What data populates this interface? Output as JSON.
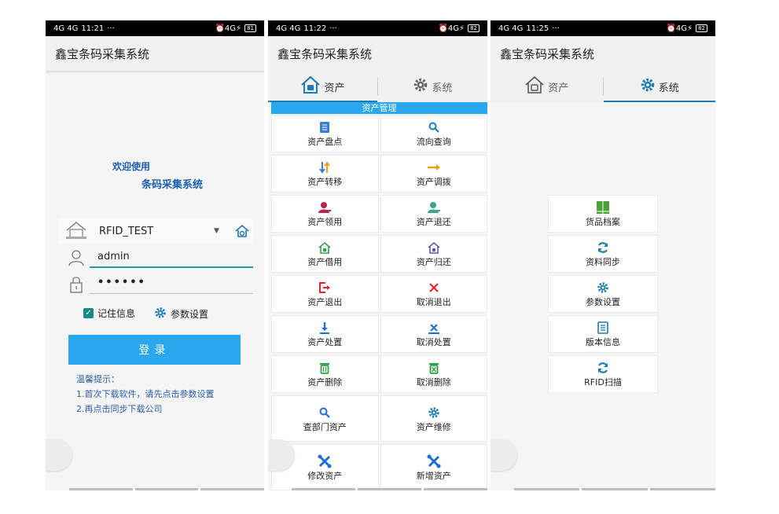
{
  "colors": {
    "accent": "#29a8f0",
    "title_blue": "#1d5fb0",
    "teal": "#1a8a7d",
    "tab_underline": "#1f7bb0"
  },
  "screen1": {
    "status": {
      "signal": "4G 4G",
      "time": "11:21",
      "dots": "···",
      "right": "⏰4G⚡",
      "battery": "81"
    },
    "app_title": "鑫宝条码采集系统",
    "welcome_line1": "欢迎使用",
    "welcome_line2": "条码采集系统",
    "database": {
      "value": "RFID_TEST",
      "icon": "company-house-icon"
    },
    "username": {
      "value": "admin"
    },
    "password": {
      "value": "••••••"
    },
    "remember_label": "记住信息",
    "params_label": "参数设置",
    "login_label": "登录",
    "tips": {
      "title": "温馨提示：",
      "line1": "1.首次下载软件，请先点击参数设置",
      "line2": "2.再点击同步下载公司"
    }
  },
  "screen2": {
    "status": {
      "signal": "4G 4G",
      "time": "11:22",
      "dots": "···",
      "right": "⏰4G⚡",
      "battery": "82"
    },
    "app_title": "鑫宝条码采集系统",
    "tabs": [
      {
        "label": "资产",
        "active": true
      },
      {
        "label": "系统",
        "active": false
      }
    ],
    "section_title": "资产管理",
    "items": [
      {
        "label": "资产盘点",
        "icon": "clipboard-icon",
        "color": "#3b7fd4"
      },
      {
        "label": "流向查询",
        "icon": "search-icon",
        "color": "#1f7bb0"
      },
      {
        "label": "资产转移",
        "icon": "transfer-arrows-icon",
        "color": "#3b7fd4"
      },
      {
        "label": "资产调拨",
        "icon": "arrow-right-icon",
        "color": "#f29b18"
      },
      {
        "label": "资产领用",
        "icon": "person-red-icon",
        "color": "#b5264a"
      },
      {
        "label": "资产退还",
        "icon": "person-teal-icon",
        "color": "#3aa58d"
      },
      {
        "label": "资产借用",
        "icon": "home-green-icon",
        "color": "#2fa144"
      },
      {
        "label": "资产归还",
        "icon": "home-purple-icon",
        "color": "#6a4fb0"
      },
      {
        "label": "资产退出",
        "icon": "exit-icon",
        "color": "#e2262c"
      },
      {
        "label": "取消退出",
        "icon": "close-icon",
        "color": "#e2262c"
      },
      {
        "label": "资产处置",
        "icon": "download-icon",
        "color": "#1f6fd1"
      },
      {
        "label": "取消处置",
        "icon": "cancel-download-icon",
        "color": "#1f6fd1"
      },
      {
        "label": "资产删除",
        "icon": "trash-icon",
        "color": "#2fa144"
      },
      {
        "label": "取消删除",
        "icon": "trash-cancel-icon",
        "color": "#2fa144"
      },
      {
        "label": "查部门资产",
        "icon": "search-icon",
        "color": "#1f6fd1"
      },
      {
        "label": "资产维修",
        "icon": "gear-icon",
        "color": "#1f7bb0"
      },
      {
        "label": "修改资产",
        "icon": "tools-icon",
        "color": "#1f6fd1"
      },
      {
        "label": "新增资产",
        "icon": "tools-icon",
        "color": "#1f6fd1"
      }
    ]
  },
  "screen3": {
    "status": {
      "signal": "4G 4G",
      "time": "11:25",
      "dots": "···",
      "right": "⏰4G⚡",
      "battery": "82"
    },
    "app_title": "鑫宝条码采集系统",
    "tabs": [
      {
        "label": "资产",
        "active": false
      },
      {
        "label": "系统",
        "active": true
      }
    ],
    "items": [
      {
        "label": "货品档案",
        "icon": "archive-icon",
        "color": "#4aa23a"
      },
      {
        "label": "资料同步",
        "icon": "sync-icon",
        "color": "#1f7bb0"
      },
      {
        "label": "参数设置",
        "icon": "gear-icon",
        "color": "#1f7bb0"
      },
      {
        "label": "版本信息",
        "icon": "document-icon",
        "color": "#1f7bb0"
      },
      {
        "label": "RFID扫描",
        "icon": "sync-icon",
        "color": "#1f7bb0"
      }
    ]
  }
}
